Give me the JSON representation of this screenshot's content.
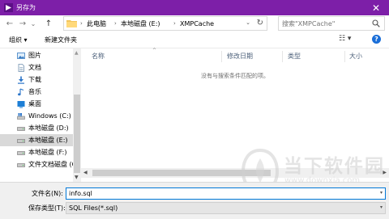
{
  "window": {
    "title": "另存为",
    "close_glyph": "✕",
    "accent_color": "#7d1fa8"
  },
  "nav": {
    "back_glyph": "←",
    "forward_glyph": "→",
    "recent_glyph": "⌄",
    "up_glyph": "↑"
  },
  "address": {
    "breadcrumbs": [
      "此电脑",
      "本地磁盘 (E:)",
      "XMPCache"
    ],
    "separator": "›",
    "dropdown_glyph": "⌄",
    "refresh_glyph": "↻"
  },
  "search": {
    "placeholder": "搜索\"XMPCache\""
  },
  "toolbar": {
    "organize_label": "组织 ▾",
    "new_folder_label": "新建文件夹",
    "view_glyph": "☷ ▾",
    "help_glyph": "?"
  },
  "sidebar": {
    "items": [
      {
        "label": "图片",
        "icon": "pictures-icon"
      },
      {
        "label": "文档",
        "icon": "documents-icon"
      },
      {
        "label": "下载",
        "icon": "downloads-icon"
      },
      {
        "label": "音乐",
        "icon": "music-icon"
      },
      {
        "label": "桌面",
        "icon": "desktop-icon"
      },
      {
        "label": "Windows (C:)",
        "icon": "windows-drive-icon"
      },
      {
        "label": "本地磁盘 (D:)",
        "icon": "drive-icon"
      },
      {
        "label": "本地磁盘 (E:)",
        "icon": "drive-icon"
      },
      {
        "label": "本地磁盘 (F:)",
        "icon": "drive-icon"
      },
      {
        "label": "文件文档磁盘 (G",
        "icon": "drive-icon"
      }
    ],
    "selected_index": 7
  },
  "filelist": {
    "columns": [
      "名称",
      "修改日期",
      "类型",
      "大小"
    ],
    "sort_glyph": "^",
    "empty_message": "没有与搜索条件匹配的项。"
  },
  "watermark": {
    "text": "当下软件园",
    "url": "www.downxia.com"
  },
  "footer": {
    "filename_label": "文件名(N):",
    "filename_value": "info.sql",
    "filetype_label": "保存类型(T):",
    "filetype_value": "SQL Files(*.sql)",
    "dropdown_glyph": "▾"
  }
}
